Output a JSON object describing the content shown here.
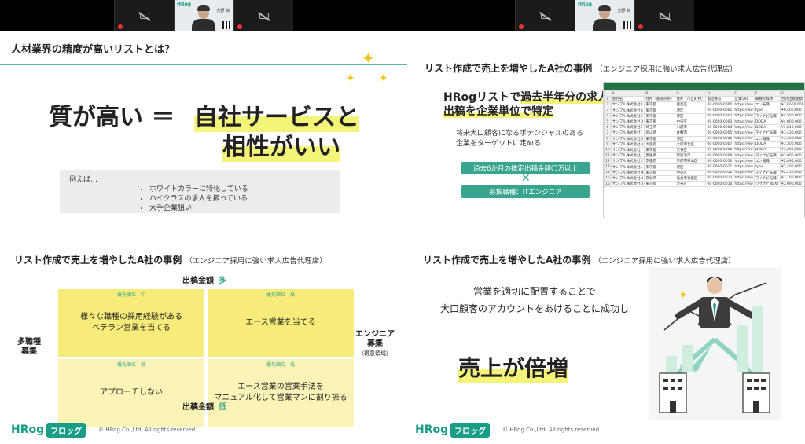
{
  "participants": {
    "left_group": {
      "video_logo": "HRog",
      "name": "大野 純"
    },
    "right_group": {
      "video_logo": "HRog",
      "name": "大野 純"
    }
  },
  "slide1": {
    "title": "人材業界の精度が高いリストとは？",
    "headline_left": "質が高い ＝",
    "headline_right": "自社サービスと",
    "headline_line2": "相性がいい",
    "example_label": "例えば…",
    "example_items": [
      "ホワイトカラーに特化している",
      "ハイクラスの求人を扱っている",
      "大手企業狙い"
    ]
  },
  "slide2": {
    "title": "リスト作成で売上を増やしたA社の事例",
    "subtitle": "（エンジニア採用に強い求人広告代理店）",
    "lead_1": "HRogリストで",
    "lead_1b": "過去半年分の求人",
    "lead_2": "出稿を企業単位で特定",
    "note": "将来大口顧客になるポテンシャルのある\n企業をターゲットに定める",
    "button_1": "過去6か月の推定出稿金額〇万以上",
    "cross": "✕",
    "button_2": "募集職種：ITエンジニア",
    "sheet_headers": [
      "",
      "A",
      "B",
      "C",
      "D",
      "E",
      "F",
      "G",
      "H"
    ],
    "sheet_header_row": [
      "会社名",
      "住所（都道府県）",
      "住所（市区町村）",
      "電話番号",
      "企業URL",
      "職種元媒体",
      "合計出稿金額"
    ],
    "sheet_rows": [
      [
        "サンプル株式会社A",
        "東京都",
        "豊島区",
        "00-0000-0000",
        "https://ww",
        "エン転職",
        "¥13,660,000"
      ],
      [
        "サンプル株式会社B",
        "東京都",
        "港区",
        "00-0000-0001",
        "https://ww",
        "type",
        "¥6,400,000"
      ],
      [
        "サンプル株式会社C",
        "東京都",
        "港区",
        "00-0000-0002",
        "https://ww",
        "マイナビ転職",
        "¥4,500,000"
      ],
      [
        "サンプル株式会社D",
        "東京都",
        "中央区",
        "00-0000-0003",
        "https://ww",
        "DODA",
        "¥4,000,000"
      ],
      [
        "サンプル株式会社E",
        "埼玉県",
        "川越市",
        "00-0000-0004",
        "https://ww",
        "DODA",
        "¥3,810,000"
      ],
      [
        "サンプル株式会社F",
        "岡山県",
        "倉敷市",
        "00-0000-0005",
        "https://ww",
        "マイナビ転職",
        "¥3,430,000"
      ],
      [
        "サンプル株式会社G",
        "東京都",
        "港区",
        "00-0000-0006",
        "https://ww",
        "エン転職",
        "¥3,400,000"
      ],
      [
        "サンプル株式会社H",
        "大阪府",
        "大阪市北区",
        "00-0000-0007",
        "https://ww",
        "DODA",
        "¥3,300,000"
      ],
      [
        "サンプル株式会社I",
        "東京都",
        "渋谷区",
        "00-0000-0008",
        "https://ww",
        "DODA",
        "¥3,200,000"
      ],
      [
        "サンプル株式会社J",
        "愛媛県",
        "新居浜市",
        "00-0000-0009",
        "https://ww",
        "マイナビ転職",
        "¥3,000,000"
      ],
      [
        "サンプル株式会社K",
        "京都府",
        "京都市東山区",
        "00-0000-0010",
        "https://ww",
        "エン転職",
        "¥2,895,000"
      ],
      [
        "サンプル株式会社L",
        "東京都",
        "港区",
        "00-0000-0011",
        "https://ww",
        "type",
        "¥2,400,000"
      ],
      [
        "サンプル株式会社M",
        "東京都",
        "中央区",
        "00-0000-0012",
        "https://ww",
        "マイナビ転職",
        "¥2,250,000"
      ],
      [
        "サンプル株式会社N",
        "宮城県",
        "仙台市青葉区",
        "00-0000-0013",
        "https://ww",
        "マイナビ転職",
        "¥2,100,000"
      ],
      [
        "サンプル株式会社O",
        "東京都",
        "渋谷区",
        "00-0000-0014",
        "https://ww",
        "リクナビNEXT",
        "¥2,095,000"
      ]
    ]
  },
  "slide3": {
    "title": "リスト作成で売上を増やしたA社の事例",
    "subtitle": "（エンジニア採用に強い求人広告代理店）",
    "top_label": "出稿金額",
    "top_accent": "多",
    "bottom_label": "出稿金額",
    "bottom_accent": "低",
    "left_label": "多職種\n募集",
    "right_label": "エンジニア\n募集",
    "right_sub": "（得意領域）",
    "cells": [
      {
        "priority": "優先順位　中",
        "text": "様々な職種の採用経験がある\nベテラン営業を当てる"
      },
      {
        "priority": "優先順位　高",
        "text": "エース営業を当てる"
      },
      {
        "priority": "優先順位　低",
        "text": "アプローチしない"
      },
      {
        "priority": "優先順位　低",
        "text": "エース営業の営業手法を\nマニュアル化して営業マンに割り振る"
      }
    ]
  },
  "slide4": {
    "title": "リスト作成で売上を増やしたA社の事例",
    "subtitle": "（エンジニア採用に強い求人広告代理店）",
    "message": "営業を適切に配置することで\n大口顧客のアカウントをあけることに成功し",
    "result": "売上が倍増"
  },
  "footer": {
    "logo": "HRog",
    "badge": "フロッグ",
    "copyright": "© HRog Co.,Ltd. All rights reserved."
  },
  "colors": {
    "accent": "#1a9d86",
    "highlight": "#f4f478",
    "cell": "#f7ec7a"
  }
}
